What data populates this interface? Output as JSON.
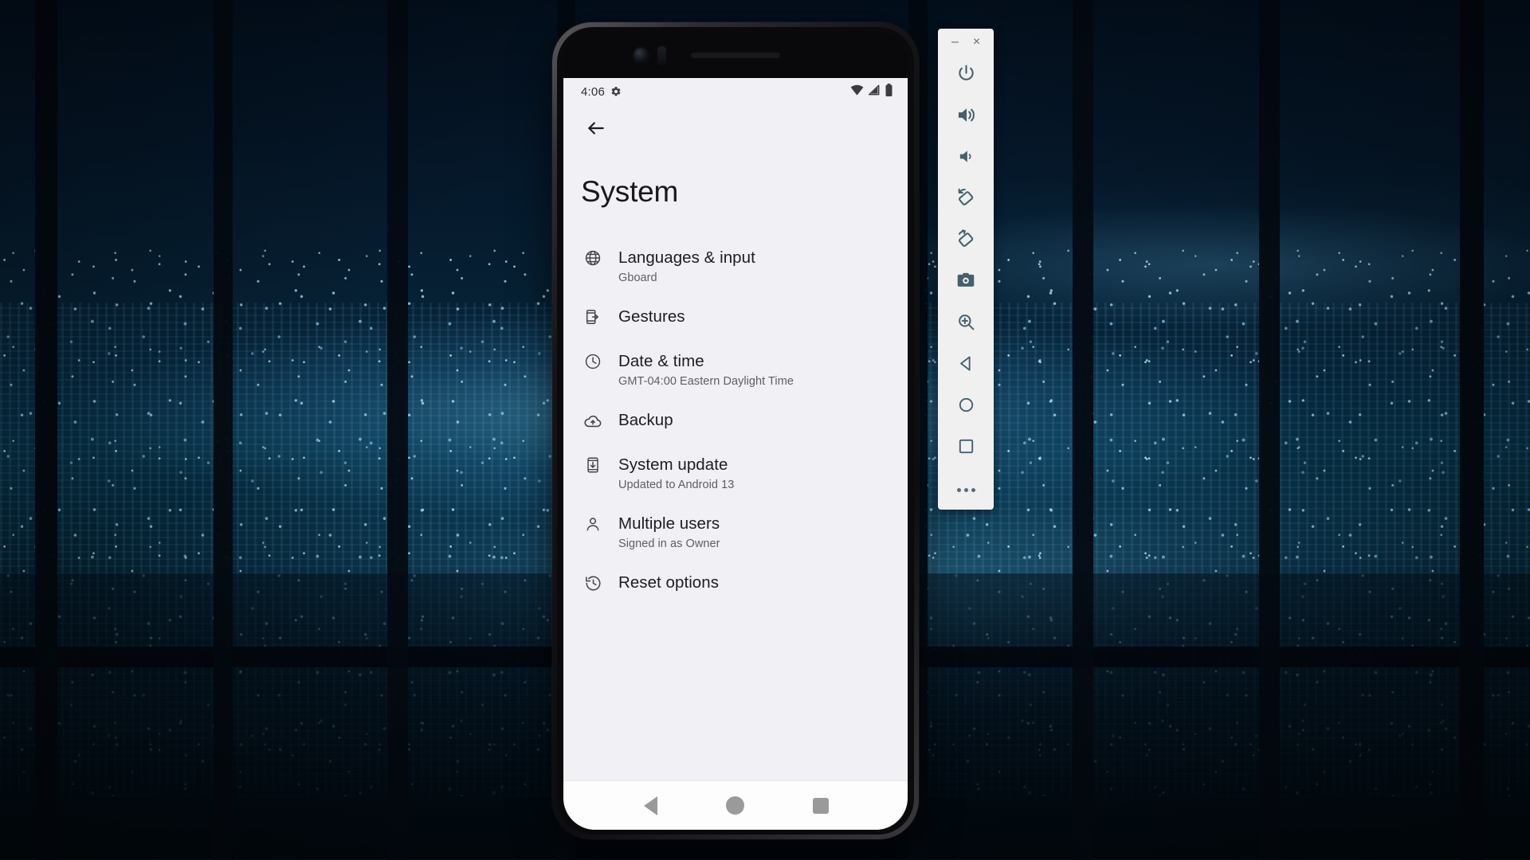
{
  "wallpaper": {
    "description": "night-city-through-window",
    "base_color": "#061525",
    "accent_color": "#6fd0ff"
  },
  "phone": {
    "status_bar": {
      "time": "4:06",
      "gear_icon": "gear-icon",
      "wifi_icon": "wifi-icon",
      "signal_icon": "cellular-signal-icon",
      "battery_icon": "battery-icon"
    },
    "app_bar": {
      "back_icon": "arrow-back-icon"
    },
    "page_title": "System",
    "settings_items": [
      {
        "icon": "globe-icon",
        "title": "Languages & input",
        "subtitle": "Gboard"
      },
      {
        "icon": "gestures-icon",
        "title": "Gestures",
        "subtitle": ""
      },
      {
        "icon": "clock-icon",
        "title": "Date & time",
        "subtitle": "GMT-04:00 Eastern Daylight Time"
      },
      {
        "icon": "cloud-upload-icon",
        "title": "Backup",
        "subtitle": ""
      },
      {
        "icon": "system-update-icon",
        "title": "System update",
        "subtitle": "Updated to Android 13"
      },
      {
        "icon": "person-icon",
        "title": "Multiple users",
        "subtitle": "Signed in as Owner"
      },
      {
        "icon": "history-restore-icon",
        "title": "Reset options",
        "subtitle": ""
      }
    ],
    "nav_bar": {
      "back_label": "Back",
      "home_label": "Home",
      "recents_label": "Recents"
    }
  },
  "emulator_toolbar": {
    "minimize_label": "–",
    "close_label": "×",
    "buttons": [
      {
        "icon": "power-icon",
        "label": "Power"
      },
      {
        "icon": "volume-up-icon",
        "label": "Volume Up"
      },
      {
        "icon": "volume-down-icon",
        "label": "Volume Down"
      },
      {
        "icon": "rotate-left-icon",
        "label": "Rotate Left"
      },
      {
        "icon": "rotate-right-icon",
        "label": "Rotate Right"
      },
      {
        "icon": "camera-icon",
        "label": "Take Screenshot"
      },
      {
        "icon": "zoom-icon",
        "label": "Zoom Mode"
      },
      {
        "icon": "back-icon",
        "label": "Back"
      },
      {
        "icon": "home-icon",
        "label": "Home"
      },
      {
        "icon": "overview-icon",
        "label": "Overview"
      }
    ],
    "more_label": "More"
  }
}
